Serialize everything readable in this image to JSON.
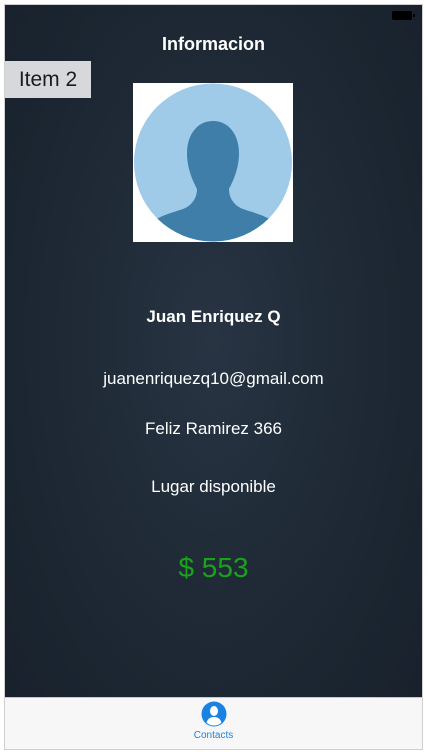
{
  "nav": {
    "title": "Informacion"
  },
  "overlay": {
    "item_label": "Item 2"
  },
  "contact": {
    "name": "Juan Enriquez Q",
    "email": "juanenriquezq10@gmail.com",
    "address": "Feliz Ramirez 366",
    "place": "Lugar disponible",
    "amount": "$ 553"
  },
  "tab_bar": {
    "items": [
      {
        "label": "Contacts",
        "icon": "person-circle-icon",
        "selected": true
      }
    ]
  },
  "colors": {
    "background": "#1f2a36",
    "amount": "#1aa31a",
    "tab_accent": "#1a82e0",
    "avatar_circle": "#9fcbe9",
    "avatar_silhouette": "#3e7ea8"
  }
}
